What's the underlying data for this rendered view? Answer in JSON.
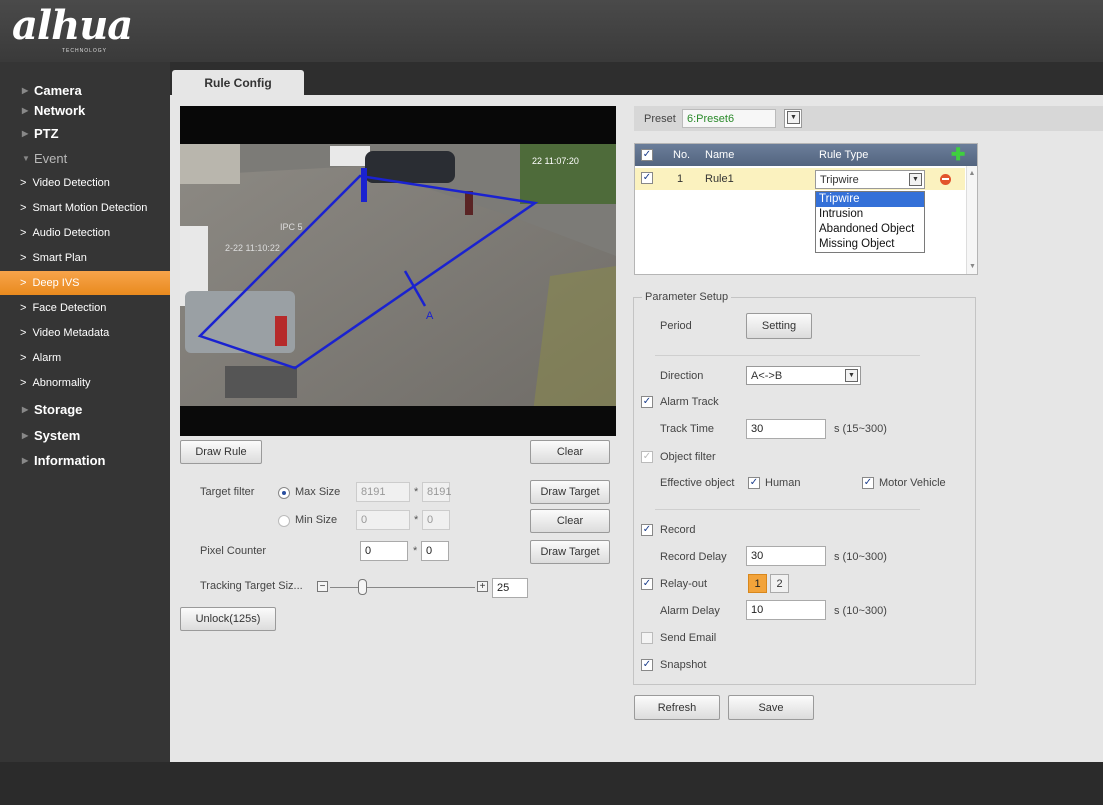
{
  "brand": {
    "logo": "alhua",
    "subtitle": "TECHNOLOGY"
  },
  "sidebar": {
    "items": [
      {
        "label": "Camera"
      },
      {
        "label": "Network"
      },
      {
        "label": "PTZ"
      },
      {
        "label": "Event"
      },
      {
        "label": "Video Detection"
      },
      {
        "label": "Smart Motion Detection"
      },
      {
        "label": "Audio Detection"
      },
      {
        "label": "Smart Plan"
      },
      {
        "label": "Deep IVS"
      },
      {
        "label": "Face Detection"
      },
      {
        "label": "Video Metadata"
      },
      {
        "label": "Alarm"
      },
      {
        "label": "Abnormality"
      },
      {
        "label": "Storage"
      },
      {
        "label": "System"
      },
      {
        "label": "Information"
      }
    ],
    "active": "Deep IVS"
  },
  "tab": {
    "label": "Rule Config"
  },
  "video": {
    "timestamp": "22 11:07:20",
    "overlay_left": "IPC 5",
    "overlay_left2": "2-22 11:10:22",
    "rule_label": "A"
  },
  "left_controls": {
    "draw_rule": "Draw Rule",
    "clear": "Clear",
    "target_filter_label": "Target filter",
    "max_size_label": "Max Size",
    "max_w": "8191",
    "max_h": "8191",
    "draw_target": "Draw Target",
    "min_size_label": "Min Size",
    "min_w": "0",
    "min_h": "0",
    "clear2": "Clear",
    "pixel_counter_label": "Pixel Counter",
    "pixel_w": "0",
    "pixel_h": "0",
    "draw_target2": "Draw Target",
    "tracking_label": "Tracking Target Siz...",
    "tracking_value": "25",
    "tracking_level": 0.22,
    "unlock": "Unlock(125s)",
    "star": "*"
  },
  "preset": {
    "label": "Preset",
    "value": "6:Preset6"
  },
  "rule_table": {
    "headers": {
      "no": "No.",
      "name": "Name",
      "type": "Rule Type"
    },
    "rows": [
      {
        "no": "1",
        "name": "Rule1",
        "type": "Tripwire"
      }
    ],
    "options": [
      "Tripwire",
      "Intrusion",
      "Abandoned Object",
      "Missing Object"
    ],
    "selected_option": "Tripwire"
  },
  "params": {
    "title": "Parameter Setup",
    "period_label": "Period",
    "setting_button": "Setting",
    "direction_label": "Direction",
    "direction_value": "A<->B",
    "alarm_track_label": "Alarm Track",
    "track_time_label": "Track Time",
    "track_time_value": "30",
    "track_time_range": "s (15~300)",
    "object_filter_label": "Object filter",
    "effective_object_label": "Effective object",
    "human_label": "Human",
    "motor_vehicle_label": "Motor Vehicle",
    "record_label": "Record",
    "record_delay_label": "Record Delay",
    "record_delay_value": "30",
    "record_delay_range": "s (10~300)",
    "relay_out_label": "Relay-out",
    "relay_1": "1",
    "relay_2": "2",
    "alarm_delay_label": "Alarm Delay",
    "alarm_delay_value": "10",
    "alarm_delay_range": "s (10~300)",
    "send_email_label": "Send Email",
    "snapshot_label": "Snapshot"
  },
  "footer_buttons": {
    "refresh": "Refresh",
    "save": "Save"
  },
  "colors": {
    "accent": "#f0962e",
    "table_header": "#5d6f8b",
    "selected_row": "#fbf2bf",
    "list_highlight": "#3470d8"
  },
  "icons": {
    "add": "plus-icon",
    "delete": "minus-circle-icon",
    "check": "check-icon"
  }
}
